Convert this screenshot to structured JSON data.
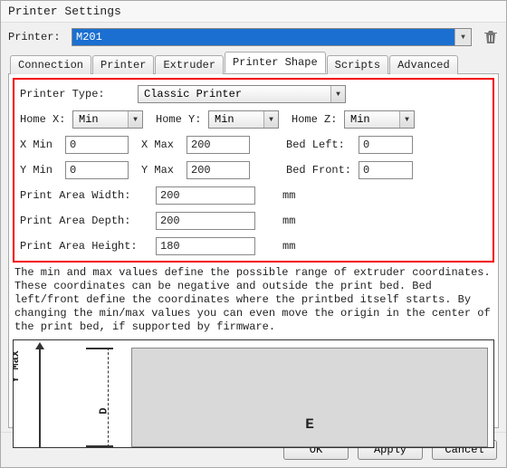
{
  "window": {
    "title": "Printer Settings"
  },
  "toolbar": {
    "printer_label": "Printer:",
    "printer_value": "M201",
    "delete_tooltip": "Delete"
  },
  "tabs": [
    {
      "label": "Connection"
    },
    {
      "label": "Printer"
    },
    {
      "label": "Extruder"
    },
    {
      "label": "Printer Shape",
      "active": true
    },
    {
      "label": "Scripts"
    },
    {
      "label": "Advanced"
    }
  ],
  "shape": {
    "printer_type_label": "Printer Type:",
    "printer_type_value": "Classic Printer",
    "home_x_label": "Home X:",
    "home_x_value": "Min",
    "home_y_label": "Home Y:",
    "home_y_value": "Min",
    "home_z_label": "Home Z:",
    "home_z_value": "Min",
    "x_min_label": "X Min",
    "x_min_value": "0",
    "x_max_label": "X Max",
    "x_max_value": "200",
    "bed_left_label": "Bed Left:",
    "bed_left_value": "0",
    "y_min_label": "Y Min",
    "y_min_value": "0",
    "y_max_label": "Y Max",
    "y_max_value": "200",
    "bed_front_label": "Bed Front:",
    "bed_front_value": "0",
    "paw_label": "Print Area Width:",
    "paw_value": "200",
    "paw_unit": "mm",
    "pad_label": "Print Area Depth:",
    "pad_value": "200",
    "pad_unit": "mm",
    "pah_label": "Print Area Height:",
    "pah_value": "180",
    "pah_unit": "mm"
  },
  "description": "The min and max values define the possible range of extruder coordinates. These coordinates can be negative and outside the print bed. Bed left/front define the coordinates where the printbed itself starts. By changing the min/max values you can even move the origin in the center of the print bed, if supported by firmware.",
  "diagram": {
    "y_label": "Y Max",
    "d_label": "D",
    "e_label": "E"
  },
  "buttons": {
    "ok": "OK",
    "apply": "Apply",
    "cancel": "Cancel"
  }
}
